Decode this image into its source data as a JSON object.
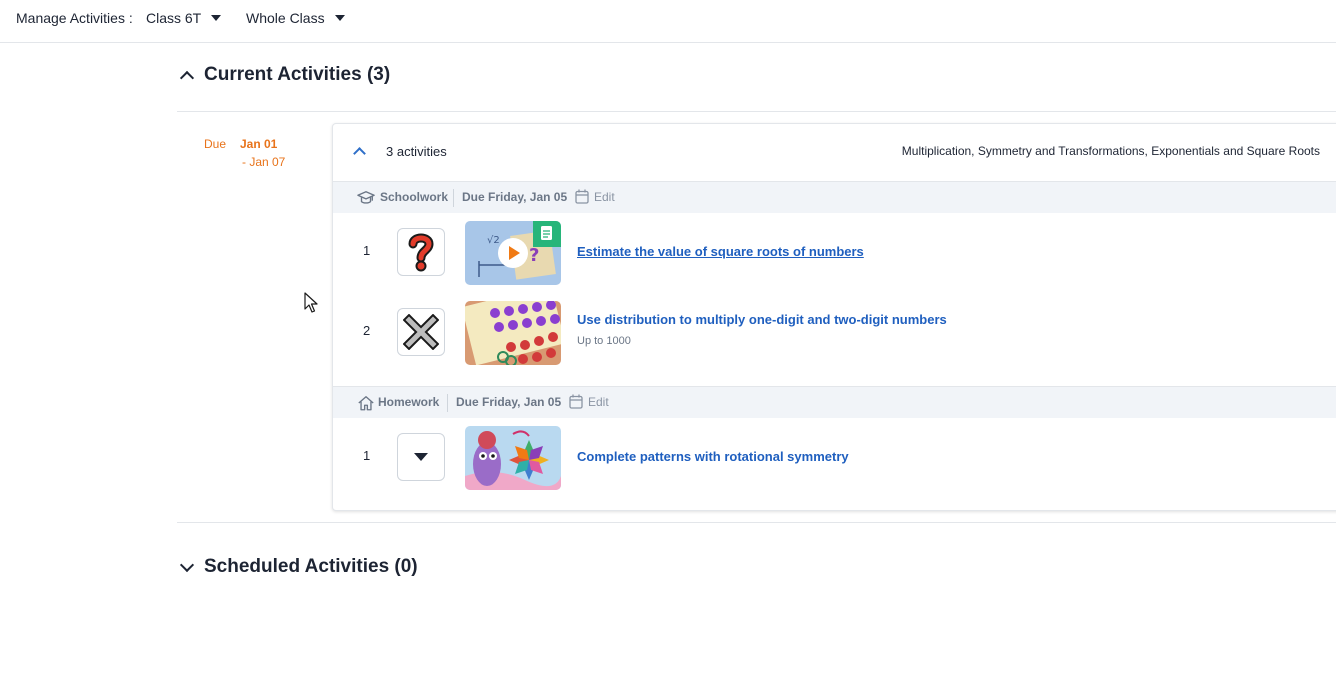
{
  "topbar": {
    "label": "Manage Activities :",
    "class_select": "Class 6T",
    "group_select": "Whole Class"
  },
  "current": {
    "title": "Current Activities (3)",
    "due_label": "Due",
    "due_start": "Jan 01",
    "due_end": "- Jan 07",
    "card": {
      "count": "3 activities",
      "topics": "Multiplication, Symmetry and Transformations, Exponentials and Square Roots",
      "groups": [
        {
          "name": "Schoolwork",
          "icon": "graduation-cap-icon",
          "due": "Due Friday, Jan 05",
          "edit": "Edit",
          "items": [
            {
              "num": "1",
              "icon": "question-mark-icon",
              "title": "Estimate the value of square roots of numbers",
              "sub": ""
            },
            {
              "num": "2",
              "icon": "multiply-x-icon",
              "title": "Use distribution to multiply one-digit and two-digit numbers",
              "sub": "Up to 1000"
            }
          ]
        },
        {
          "name": "Homework",
          "icon": "house-icon",
          "due": "Due Friday, Jan 05",
          "edit": "Edit",
          "items": [
            {
              "num": "1",
              "icon": "caret-down-icon",
              "title": "Complete patterns with rotational symmetry",
              "sub": ""
            }
          ]
        }
      ]
    }
  },
  "scheduled": {
    "title": "Scheduled Activities (0)"
  },
  "colors": {
    "due_orange": "#e8731a",
    "link_blue": "#1f5fbf",
    "group_bar": "#f1f4f8"
  }
}
